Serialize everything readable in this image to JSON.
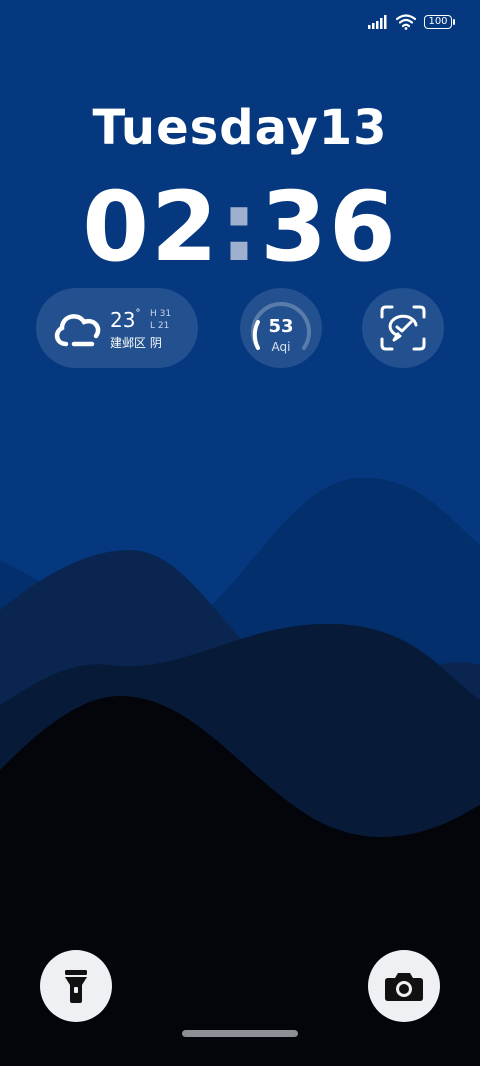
{
  "status_bar": {
    "signal_icon": "cellular-signal-icon",
    "wifi_icon": "wifi-icon",
    "battery_level": "100"
  },
  "lock_screen": {
    "date": "Tuesday13",
    "time_hours": "02",
    "time_separator": ":",
    "time_minutes": "36"
  },
  "weather": {
    "icon": "cloudy-icon",
    "temperature": "23",
    "degree_symbol": "°",
    "high": "H 31",
    "low": "L 21",
    "location_condition": "建邺区 阴"
  },
  "aqi": {
    "value": "53",
    "label": "Aqi"
  },
  "scanner": {
    "icon": "scan-check-icon"
  },
  "shortcuts": {
    "flashlight_icon": "flashlight-icon",
    "camera_icon": "camera-icon"
  },
  "colors": {
    "background_top": "#05387f",
    "wave_dark": "#03050a"
  }
}
